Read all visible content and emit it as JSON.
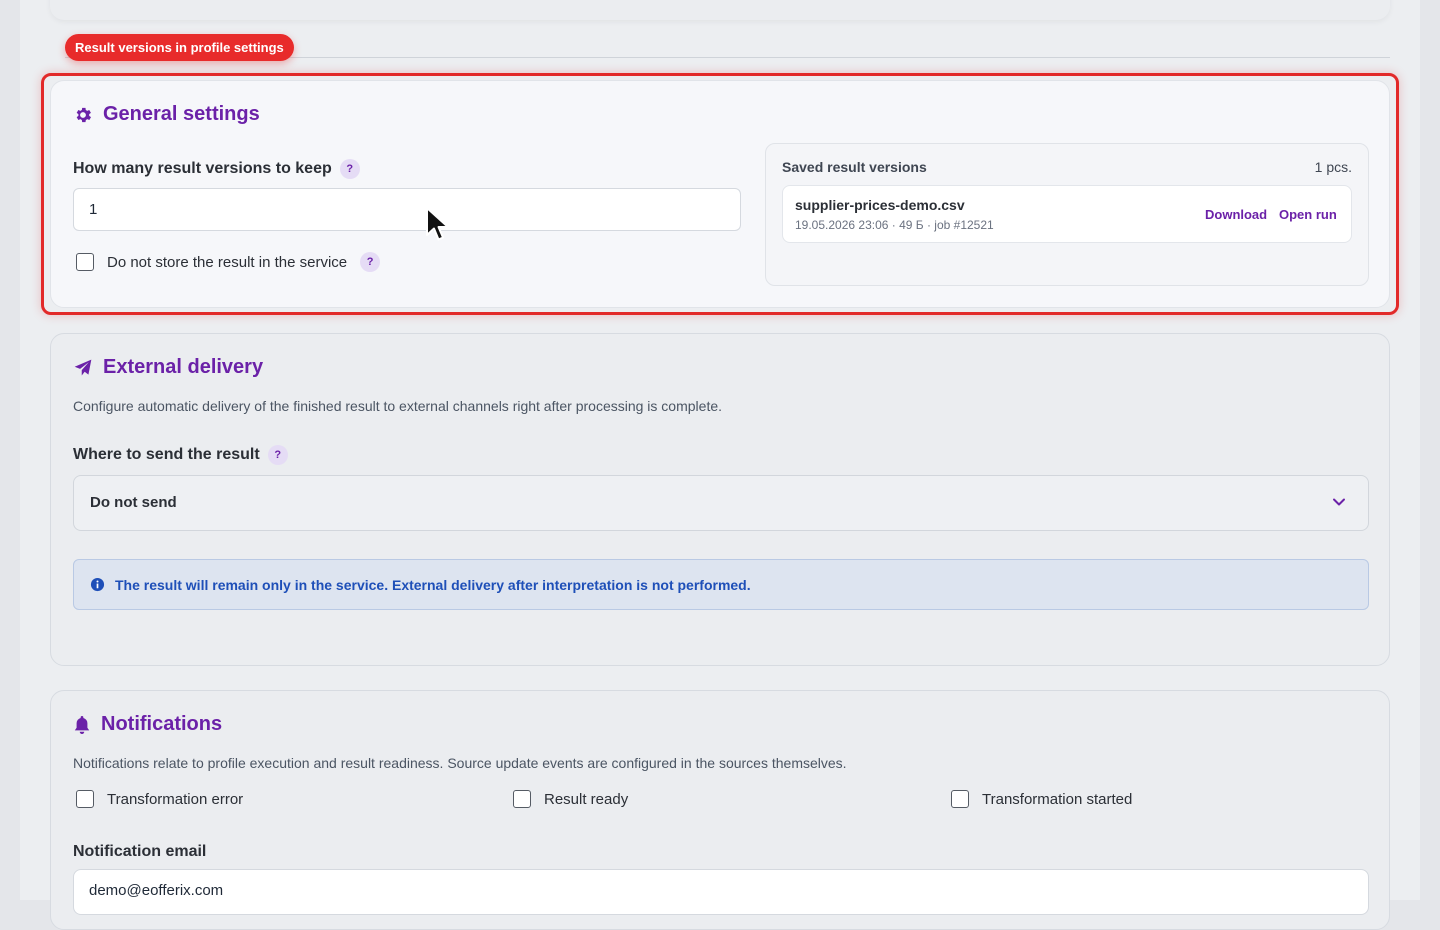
{
  "annotation": {
    "tag": "Result versions in profile settings"
  },
  "general": {
    "title": "General settings",
    "icon": "gear-icon",
    "keep_label": "How many result versions to keep",
    "keep_value": "1",
    "no_store_label": "Do not store the result in the service",
    "help": "?",
    "saved": {
      "title": "Saved result versions",
      "count": "1 pcs.",
      "items": [
        {
          "name": "supplier-prices-demo.csv",
          "meta": "19.05.2026 23:06 · 49 Б · job #12521",
          "download": "Download",
          "open": "Open run"
        }
      ]
    }
  },
  "delivery": {
    "title": "External delivery",
    "icon": "paper-plane-icon",
    "description": "Configure automatic delivery of the finished result to external channels right after processing is complete.",
    "where_label": "Where to send the result",
    "select_value": "Do not send",
    "info": "The result will remain only in the service. External delivery after interpretation is not performed."
  },
  "notifications": {
    "title": "Notifications",
    "icon": "bell-icon",
    "description": "Notifications relate to profile execution and result readiness. Source update events are configured in the sources themselves.",
    "options": [
      "Transformation error",
      "Result ready",
      "Transformation started"
    ],
    "email_label": "Notification email",
    "email_value": "demo@eofferix.com"
  },
  "colors": {
    "accent": "#6b21a8",
    "highlight": "#e22a2a",
    "info": "#1e4fb8"
  }
}
